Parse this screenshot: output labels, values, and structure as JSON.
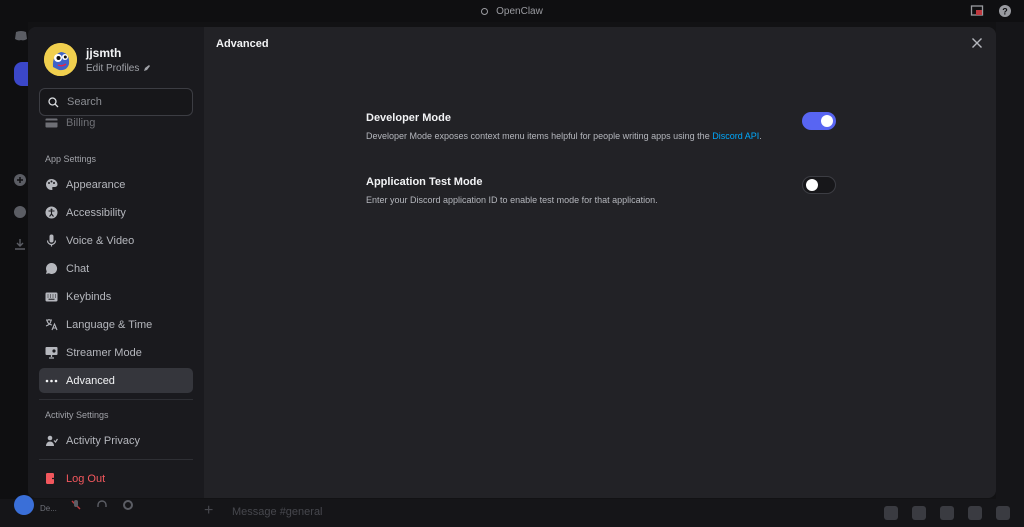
{
  "window": {
    "title": "OpenClaw"
  },
  "profile": {
    "username": "jjsmth",
    "edit_label": "Edit Profiles"
  },
  "search": {
    "placeholder": "Search"
  },
  "sidebar": {
    "billing_label": "Billing",
    "app_settings_header": "App Settings",
    "app_items": [
      {
        "label": "Appearance",
        "icon": "palette-icon"
      },
      {
        "label": "Accessibility",
        "icon": "accessibility-icon"
      },
      {
        "label": "Voice & Video",
        "icon": "microphone-icon"
      },
      {
        "label": "Chat",
        "icon": "chat-bubble-icon"
      },
      {
        "label": "Keybinds",
        "icon": "keyboard-icon"
      },
      {
        "label": "Language & Time",
        "icon": "language-icon"
      },
      {
        "label": "Streamer Mode",
        "icon": "monitor-icon"
      },
      {
        "label": "Advanced",
        "icon": "more-dots-icon",
        "active": true
      }
    ],
    "activity_settings_header": "Activity Settings",
    "activity_items": [
      {
        "label": "Activity Privacy",
        "icon": "people-icon"
      }
    ],
    "logout_label": "Log Out"
  },
  "main": {
    "title": "Advanced",
    "settings": [
      {
        "title": "Developer Mode",
        "description_prefix": "Developer Mode exposes context menu items helpful for people writing apps using the ",
        "link_text": "Discord API",
        "description_suffix": ".",
        "enabled": true
      },
      {
        "title": "Application Test Mode",
        "description": "Enter your Discord application ID to enable test mode for that application.",
        "enabled": false
      }
    ]
  },
  "background": {
    "message_placeholder": "Message #general",
    "user_short": "De..."
  },
  "colors": {
    "accent": "#5865f2",
    "link": "#00a8fc",
    "danger": "#f2575d"
  }
}
